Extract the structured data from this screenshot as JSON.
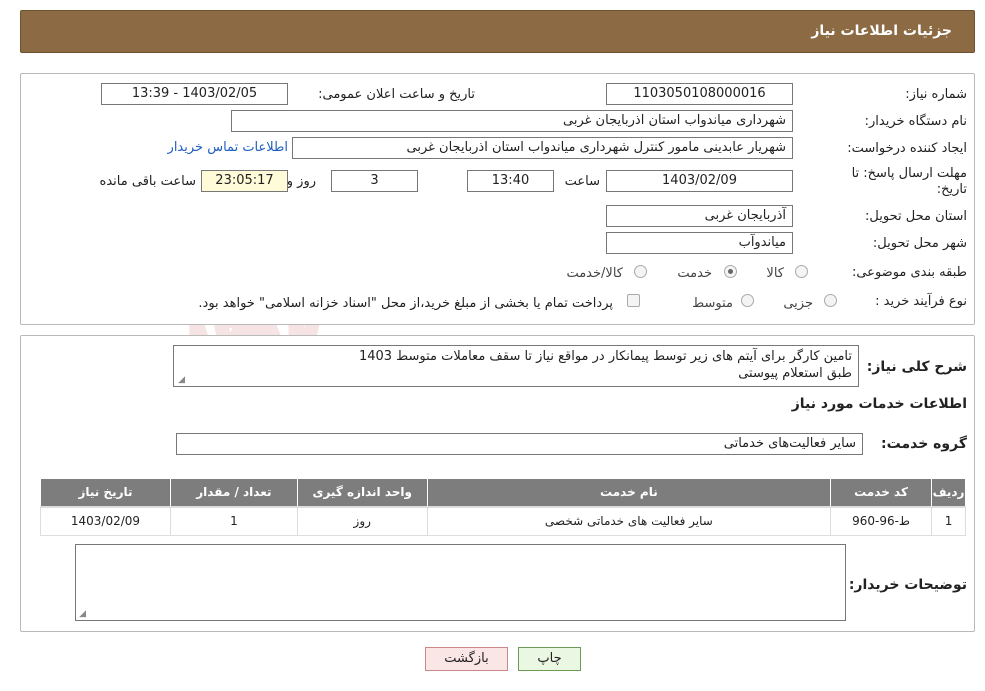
{
  "header": {
    "title": "جزئیات اطلاعات نیاز"
  },
  "fields": {
    "need_number_label": "شماره نیاز:",
    "need_number": "1103050108000016",
    "announce_label": "تاریخ و ساعت اعلان عمومی:",
    "announce_value": "1403/02/05 - 13:39",
    "buyer_label": "نام دستگاه خریدار:",
    "buyer_value": "شهرداری میاندواب استان اذربایجان غربی",
    "creator_label": "ایجاد کننده درخواست:",
    "creator_value": "شهریار  عابدینی مامور کنترل شهرداری میاندواب استان اذربایجان غربی",
    "contact_link": "اطلاعات تماس خریدار",
    "deadline_label_1": "مهلت ارسال پاسخ: تا",
    "deadline_label_2": "تاریخ:",
    "deadline_date": "1403/02/09",
    "time_label": "ساعت",
    "deadline_time": "13:40",
    "days_value": "3",
    "days_label": "روز و",
    "remaining_value": "23:05:17",
    "remaining_label": "ساعت باقی مانده",
    "province_label": "استان محل تحویل:",
    "province_value": "آذربایجان غربی",
    "city_label": "شهر محل تحویل:",
    "city_value": "میاندوآب",
    "category_label": "طبقه بندی موضوعی:",
    "category_options": [
      "کالا",
      "خدمت",
      "کالا/خدمت"
    ],
    "category_selected": "خدمت",
    "process_label": "نوع فرآیند خرید :",
    "process_options": [
      "جزیی",
      "متوسط"
    ],
    "process_note": "پرداخت تمام یا بخشی از مبلغ خرید،از محل \"اسناد خزانه اسلامی\" خواهد بود."
  },
  "summary": {
    "label": "شرح کلی نیاز:",
    "text_line1": "تامین کارگر برای آیتم های زیر توسط پیمانکار در مواقع نیاز تا سقف معاملات متوسط 1403",
    "text_line2": "طبق استعلام پیوستی"
  },
  "services": {
    "heading": "اطلاعات خدمات مورد نیاز",
    "group_label": "گروه خدمت:",
    "group_value": "سایر فعالیت‌های خدماتی",
    "columns": [
      "ردیف",
      "کد خدمت",
      "نام خدمت",
      "واحد اندازه گیری",
      "تعداد / مقدار",
      "تاریخ نیاز"
    ],
    "rows": [
      [
        "1",
        "ط-96-960",
        "سایر فعالیت های خدماتی شخصی",
        "روز",
        "1",
        "1403/02/09"
      ]
    ]
  },
  "buyer_notes": {
    "label": "توضیحات خریدار:",
    "text": ""
  },
  "buttons": {
    "print": "چاپ",
    "back": "بازگشت"
  },
  "watermark": {
    "text": "AriaTender.neT"
  },
  "colors": {
    "header": "#8c6b44",
    "table_header": "#7d7d7d",
    "link": "#1f5fbf"
  }
}
